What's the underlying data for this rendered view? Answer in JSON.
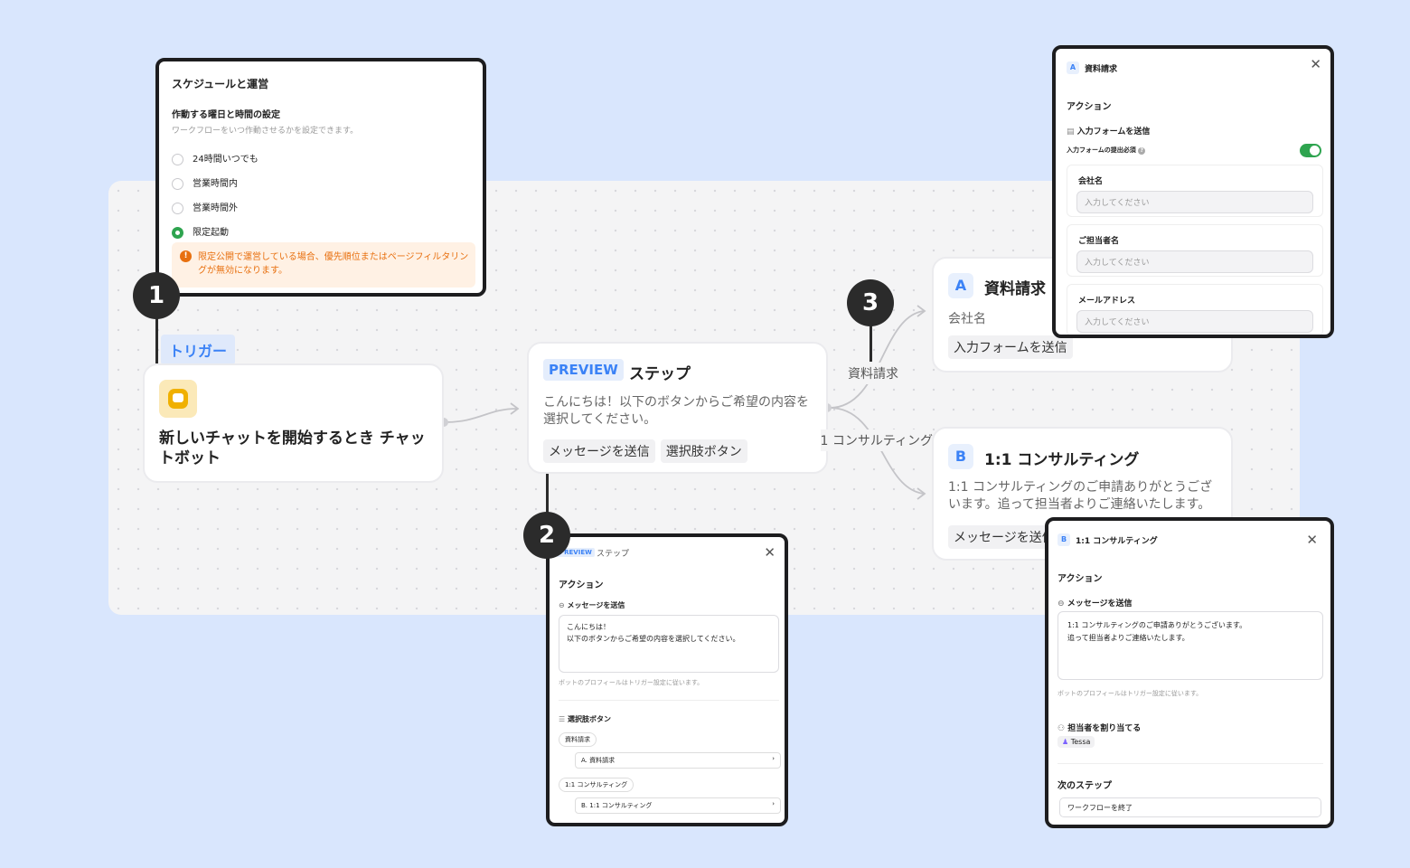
{
  "trigger": {
    "label": "トリガー",
    "title": "新しいチャットを開始するとき チャットボット"
  },
  "step": {
    "badge": "PREVIEW",
    "title": "ステップ",
    "text": "こんにちは！以下のボタンからご希望の内容を選択してください。",
    "tags": [
      "メッセージを送信",
      "選択肢ボタン"
    ]
  },
  "branches": {
    "label_a": "資料請求",
    "label_b": "1:1 コンサルティング"
  },
  "node_a": {
    "letter": "A",
    "title": "資料請求",
    "text": "会社名",
    "tag": "入力フォームを送信"
  },
  "node_b": {
    "letter": "B",
    "title": "1:1 コンサルティング",
    "text": "1:1 コンサルティングのご申請ありがとうございます。追って担当者よりご連絡いたします。",
    "tag": "メッセージを送信"
  },
  "markers": [
    "1",
    "2",
    "3"
  ],
  "popup1": {
    "title": "スケジュールと運営",
    "section": "作動する曜日と時間の設定",
    "desc": "ワークフローをいつ作動させるかを設定できます。",
    "options": [
      {
        "label": "24時間いつでも",
        "selected": false
      },
      {
        "label": "営業時間内",
        "selected": false
      },
      {
        "label": "営業時間外",
        "selected": false
      },
      {
        "label": "限定起動",
        "selected": true
      }
    ],
    "warning": "限定公開で運営している場合、優先順位またはページフィルタリングが無効になります。"
  },
  "popup2": {
    "badge": "PREVIEW",
    "title": "ステップ",
    "action": "アクション",
    "send_label": "メッセージを送信",
    "message_line1": "こんにちは！",
    "message_line2": "以下のボタンからご希望の内容を選択してください。",
    "profile_note": "ボットのプロフィールはトリガー設定に従います。",
    "buttons_label": "選択肢ボタン",
    "choices": [
      {
        "button": "資料請求",
        "target": "A. 資料請求"
      },
      {
        "button": "1:1 コンサルティング",
        "target": "B. 1:1 コンサルティング"
      }
    ]
  },
  "popup3": {
    "letter": "A",
    "title": "資料請求",
    "action": "アクション",
    "form_label": "入力フォームを送信",
    "required_label": "入力フォームの提出必須",
    "required_on": true,
    "fields": [
      {
        "label": "会社名",
        "placeholder": "入力してください"
      },
      {
        "label": "ご担当者名",
        "placeholder": "入力してください"
      },
      {
        "label": "メールアドレス",
        "placeholder": "入力してください"
      }
    ]
  },
  "popup4": {
    "letter": "B",
    "title": "1:1 コンサルティング",
    "action": "アクション",
    "send_label": "メッセージを送信",
    "message_line1": "1:1 コンサルティングのご申請ありがとうございます。",
    "message_line2": "追って担当者よりご連絡いたします。",
    "profile_note": "ボットのプロフィールはトリガー設定に従います。",
    "assign_label": "担当者を割り当てる",
    "assignee": "Tessa",
    "next_label": "次のステップ",
    "next_value": "ワークフローを終了"
  },
  "colors": {
    "background": "#d9e6fd",
    "accent": "#3b82f6",
    "success": "#2ea44f",
    "warning": "#e8700f"
  }
}
